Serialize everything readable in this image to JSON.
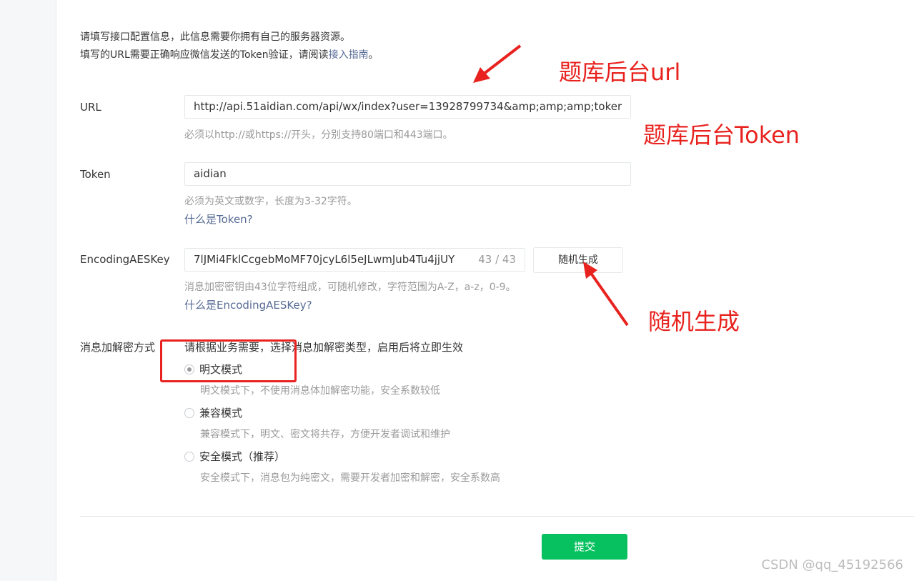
{
  "intro": {
    "line1": "请填写接口配置信息，此信息需要你拥有自己的服务器资源。",
    "line2_prefix": "填写的URL需要正确响应微信发送的Token验证，请阅读",
    "line2_link": "接入指南",
    "line2_suffix": "。"
  },
  "url_field": {
    "label": "URL",
    "value": "http://api.51aidian.com/api/wx/index?user=13928799734&amp;amp;amp;toker",
    "hint": "必须以http://或https://开头，分别支持80端口和443端口。"
  },
  "token_field": {
    "label": "Token",
    "value": "aidian",
    "hint": "必须为英文或数字，长度为3-32字符。",
    "help_link": "什么是Token?"
  },
  "aes_field": {
    "label": "EncodingAESKey",
    "value": "7lJMi4FklCcgebMoMF70jcyL6l5eJLwmJub4Tu4jjUY",
    "counter": "43 / 43",
    "random_button": "随机生成",
    "hint": "消息加密密钥由43位字符组成，可随机修改，字符范围为A-Z，a-z，0-9。",
    "help_link": "什么是EncodingAESKey?"
  },
  "encryption": {
    "label": "消息加解密方式",
    "description": "请根据业务需要，选择消息加解密类型，启用后将立即生效",
    "options": [
      {
        "label": "明文模式",
        "desc": "明文模式下，不使用消息体加解密功能，安全系数较低",
        "checked": true
      },
      {
        "label": "兼容模式",
        "desc": "兼容模式下，明文、密文将共存，方便开发者调试和维护",
        "checked": false
      },
      {
        "label": "安全模式（推荐）",
        "desc": "安全模式下，消息包为纯密文，需要开发者加密和解密，安全系数高",
        "checked": false
      }
    ]
  },
  "submit_label": "提交",
  "watermark": "CSDN @qq_45192566",
  "annotations": {
    "url_note": "题库后台url",
    "token_note": "题库后台Token",
    "random_note": "随机生成",
    "color": "#e8231f"
  },
  "colors": {
    "accent_green": "#07c160",
    "link_blue": "#576b95"
  }
}
